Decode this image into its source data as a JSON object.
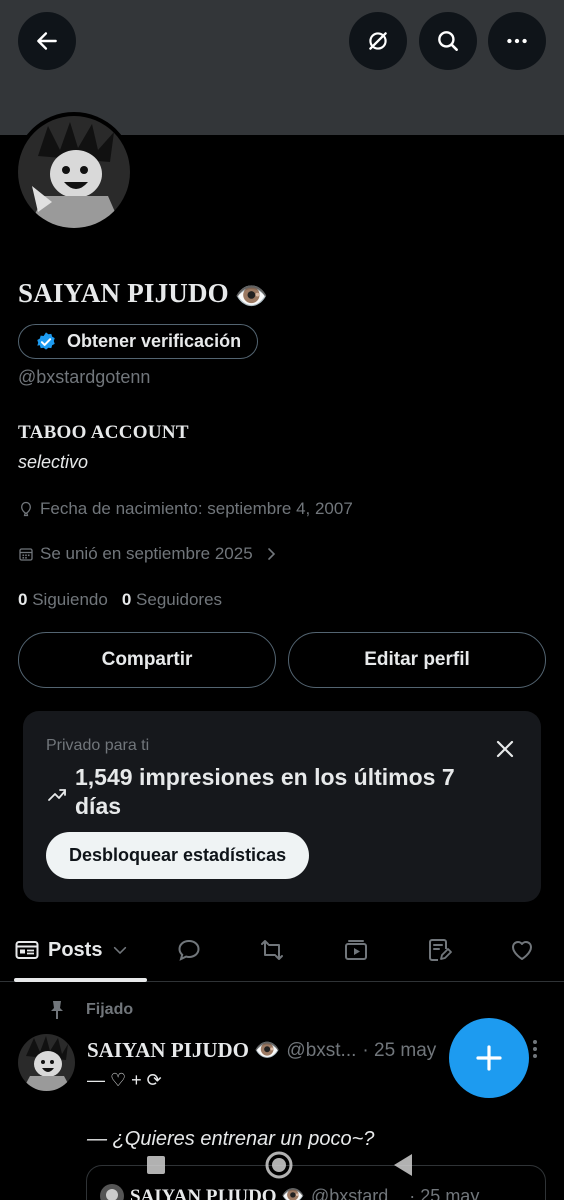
{
  "profile": {
    "name": "SAIYAN PIJUDO",
    "name_emoji": "👁️",
    "verify_label": "Obtener verificación",
    "handle": "@bxstardgotenn",
    "bio_line1": "TABOO ACCOUNT",
    "bio_line2": "selectivo",
    "birthday": "Fecha de nacimiento: septiembre 4, 2007",
    "joined": "Se unió en septiembre 2025",
    "following_count": "0",
    "following_label": "Siguiendo",
    "followers_count": "0",
    "followers_label": "Seguidores"
  },
  "buttons": {
    "share": "Compartir",
    "edit": "Editar perfil"
  },
  "insights": {
    "label": "Privado para ti",
    "impressions": "1,549 impresiones en los últimos 7 días",
    "unlock": "Desbloquear estadísticas"
  },
  "tabs": {
    "active_label": "Posts"
  },
  "post": {
    "pinned_label": "Fijado",
    "author_name": "SAIYAN PIJUDO 👁️",
    "author_handle": "@bxst...",
    "date": "· 25 may",
    "line1": "— ♡ + ⟳",
    "line2": "— ¿Quieres entrenar un poco~?",
    "quote_name": "SAIYAN PIJUDO 👁️",
    "quote_handle": "@bxstard...",
    "quote_date": "· 25 may"
  },
  "colors": {
    "accent": "#1d9bf0",
    "background": "#000000",
    "banner": "#333639",
    "muted_text": "#71767b",
    "card_bg": "#16181c"
  },
  "icons": {
    "back": "arrow-left-icon",
    "grok": "grok-icon",
    "search": "search-icon",
    "more": "more-icon",
    "verified": "verified-badge-icon",
    "birthday": "balloon-icon",
    "calendar": "calendar-icon",
    "close": "close-icon",
    "trend": "trend-up-icon",
    "compose": "plus-icon"
  }
}
